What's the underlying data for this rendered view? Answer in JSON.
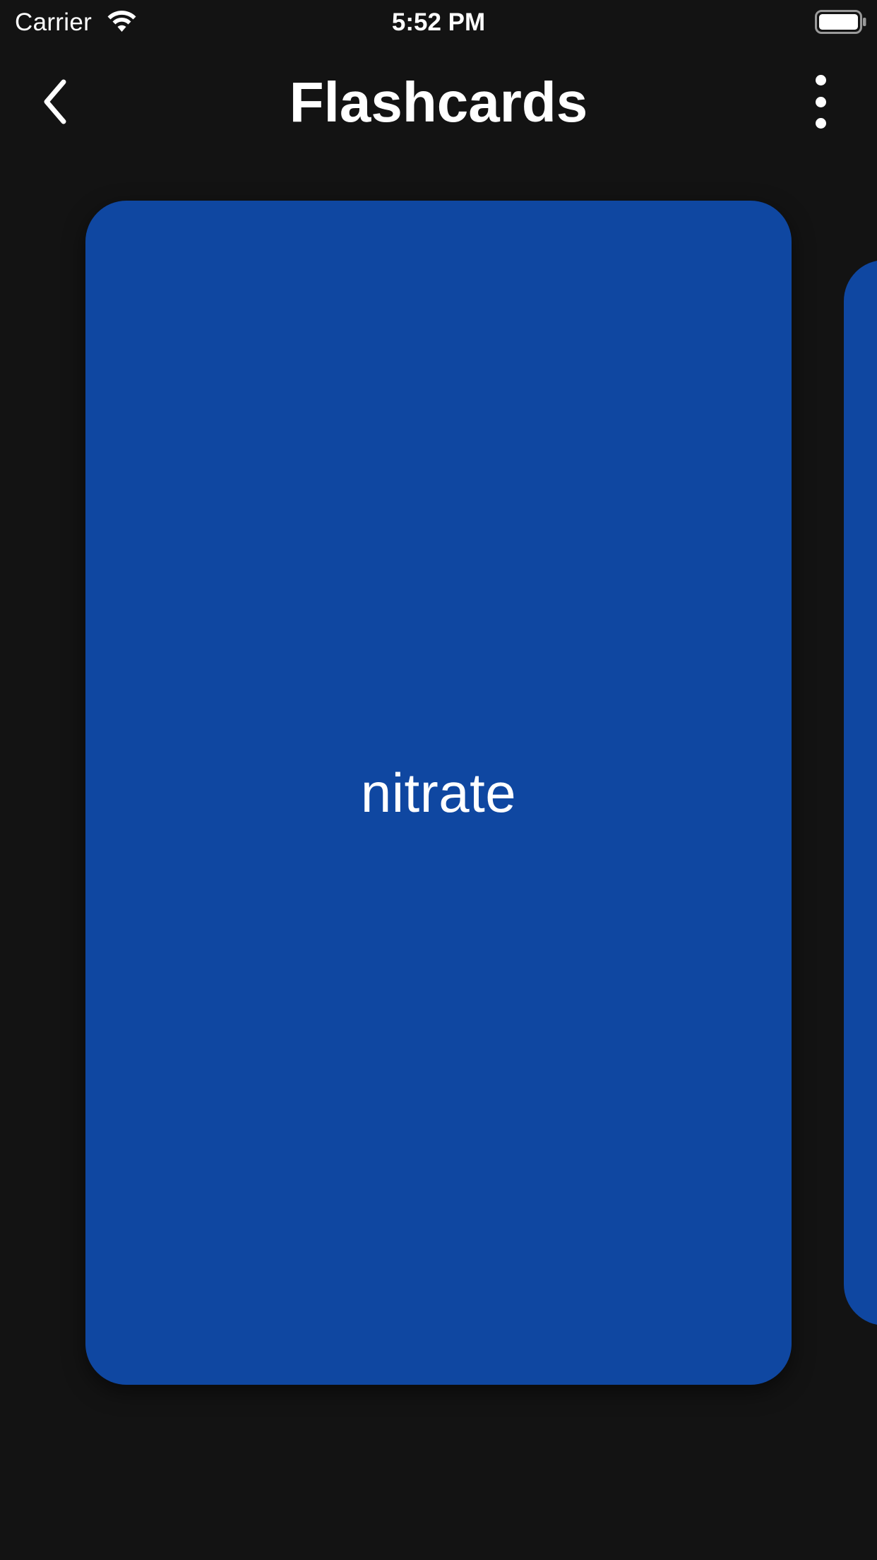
{
  "status_bar": {
    "carrier": "Carrier",
    "time": "5:52 PM",
    "icons": [
      "wifi-icon",
      "battery-icon"
    ]
  },
  "nav": {
    "title": "Flashcards",
    "back_icon": "chevron-left-icon",
    "more_icon": "more-vertical-icon"
  },
  "cards": [
    {
      "term": "nitrate",
      "color": "#0f47a1"
    }
  ],
  "theme": {
    "background": "#131313",
    "card_color": "#0f47a1",
    "text_color": "#ffffff"
  }
}
